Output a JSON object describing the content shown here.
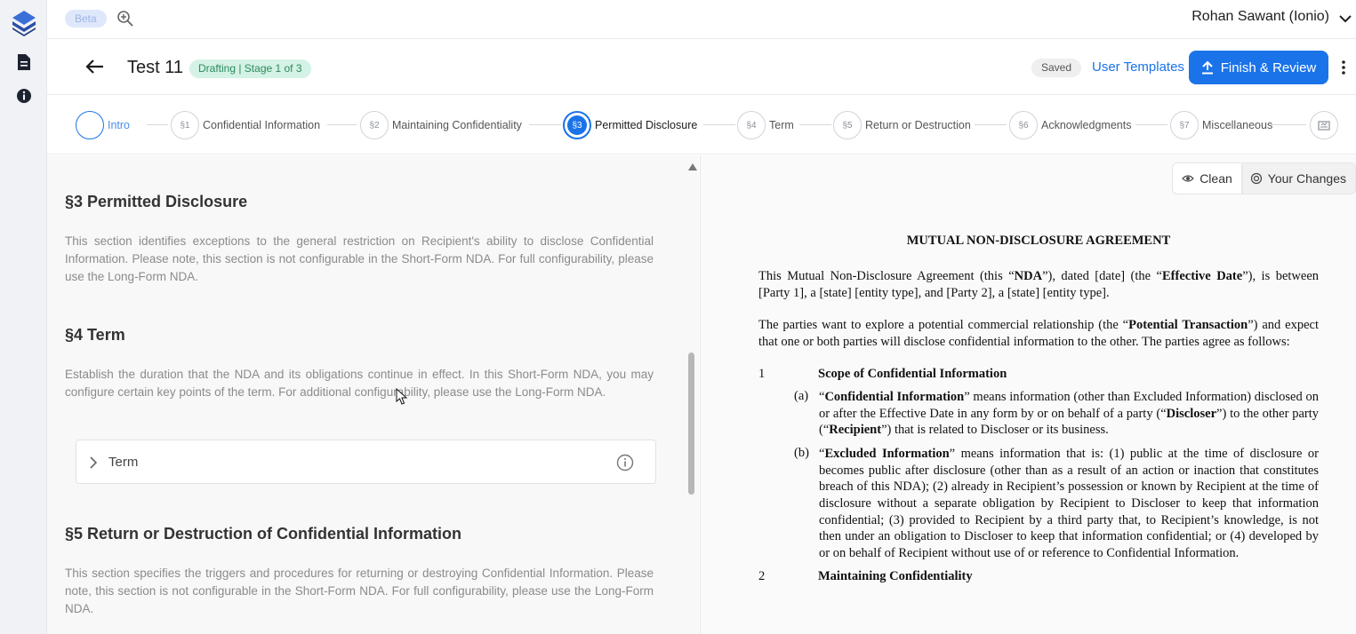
{
  "rail": {
    "icons": [
      "layers-logo-icon",
      "document-icon",
      "info-icon"
    ]
  },
  "topbar": {
    "beta_label": "Beta",
    "user_name": "Rohan Sawant (Ionio)"
  },
  "header": {
    "title": "Test 11",
    "stage_badge": "Drafting | Stage 1 of 3",
    "saved_badge": "Saved",
    "templates_link": "User Templates",
    "finish_button": "Finish & Review"
  },
  "stepper": {
    "steps": [
      {
        "num": "",
        "label": "Intro"
      },
      {
        "num": "§1",
        "label": "Confidential Information"
      },
      {
        "num": "§2",
        "label": "Maintaining Confidentiality"
      },
      {
        "num": "§3",
        "label": "Permitted Disclosure"
      },
      {
        "num": "§4",
        "label": "Term"
      },
      {
        "num": "§5",
        "label": "Return or Destruction"
      },
      {
        "num": "§6",
        "label": "Acknowledgments"
      },
      {
        "num": "§7",
        "label": "Miscellaneous"
      }
    ],
    "active_index": 3
  },
  "left": {
    "s3_title": "§3 Permitted Disclosure",
    "s3_text": "This section identifies exceptions to the general restriction on Recipient's ability to disclose Confidential Information. Please note, this section is not configurable in the Short-Form NDA. For full configurability, please use the Long-Form NDA.",
    "s4_title": "§4 Term",
    "s4_text": "Establish the duration that the NDA and its obligations continue in effect. In this Short-Form NDA, you may configure certain key points of the term. For additional configurability, please use the Long-Form NDA.",
    "term_accordion": "Term",
    "s5_title": "§5 Return or Destruction of Confidential Information",
    "s5_text": "This section specifies the triggers and procedures for returning or destroying Confidential Information. Please note, this section is not configurable in the Short-Form NDA. For full configurability, please use the Long-Form NDA."
  },
  "right": {
    "toggle_clean": "Clean",
    "toggle_changes": "Your Changes",
    "doc_title": "MUTUAL NON-DISCLOSURE AGREEMENT",
    "p1_a": "This Mutual Non-Disclosure Agreement (this “",
    "p1_b": "NDA",
    "p1_c": "”), dated [date] (the “",
    "p1_d": "Effective Date",
    "p1_e": "”), is between [Party 1], a [state] [entity type], and [Party 2], a [state] [entity type].",
    "p2_a": "The parties want to explore a potential commercial relationship (the “",
    "p2_b": "Potential Transaction",
    "p2_c": "”) and expect that one or both parties will disclose confidential information to the other. The parties agree as follows:",
    "c1_num": "1",
    "c1_title": "Scope of Confidential Information",
    "a_label": "(a)",
    "a_1": "“",
    "a_2": "Confidential Information",
    "a_3": "” means information (other than Excluded Information) disclosed on or after the Effective Date in any form by or on behalf of a party (“",
    "a_4": "Discloser",
    "a_5": "”) to the other party (“",
    "a_6": "Recipient",
    "a_7": "”) that is related to Discloser or its business.",
    "b_label": "(b)",
    "b_1": "“",
    "b_2": "Excluded Information",
    "b_3": "” means information that is: (1) public at the time of disclosure or becomes public after disclosure (other than as a result of an action or inaction that constitutes breach of this NDA); (2) already in Recipient’s possession or known by Recipient at the time of disclosure without a separate obligation by Recipient to Discloser to keep that information confidential; (3) provided to Recipient by a third party that, to Recipient’s knowledge, is not then under an obligation to Discloser to keep that information confidential; or (4) developed by or on behalf of Recipient without use of or reference to Confidential Information.",
    "c2_num": "2",
    "c2_title": "Maintaining Confidentiality"
  },
  "colors": {
    "accent": "#1a73e8",
    "stage_bg": "#d4f2e5",
    "stage_fg": "#2c8a5d"
  }
}
